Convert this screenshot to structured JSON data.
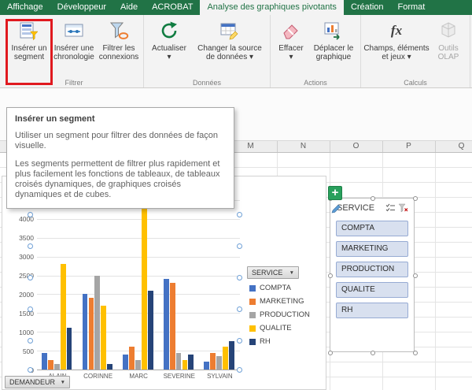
{
  "tab_bar": {
    "tabs": [
      {
        "label": "Affichage",
        "active": false
      },
      {
        "label": "Développeur",
        "active": false
      },
      {
        "label": "Aide",
        "active": false
      },
      {
        "label": "ACROBAT",
        "active": false
      },
      {
        "label": "Analyse des graphiques pivotants",
        "active": true
      },
      {
        "label": "Création",
        "active": false
      },
      {
        "label": "Format",
        "active": false
      }
    ]
  },
  "ribbon": {
    "groups": [
      {
        "label": "Filtrer",
        "buttons": [
          {
            "name": "insert-slicer",
            "line1": "Insérer un",
            "line2": "segment",
            "icon": "slicer-icon",
            "has_caret": false,
            "disabled": false
          },
          {
            "name": "insert-timeline",
            "line1": "Insérer une",
            "line2": "chronologie",
            "icon": "timeline-icon",
            "has_caret": false,
            "disabled": false
          },
          {
            "name": "filter-connections",
            "line1": "Filtrer les",
            "line2": "connexions",
            "icon": "filter-connections-icon",
            "has_caret": false,
            "disabled": false
          }
        ]
      },
      {
        "label": "Données",
        "buttons": [
          {
            "name": "refresh",
            "line1": "Actualiser",
            "line2": "",
            "icon": "refresh-icon",
            "has_caret": true,
            "disabled": false
          },
          {
            "name": "change-data-source",
            "line1": "Changer la source",
            "line2": "de données",
            "icon": "change-source-icon",
            "has_caret": true,
            "disabled": false
          }
        ]
      },
      {
        "label": "Actions",
        "buttons": [
          {
            "name": "clear",
            "line1": "Effacer",
            "line2": "",
            "icon": "clear-icon",
            "has_caret": true,
            "disabled": false
          },
          {
            "name": "move-chart",
            "line1": "Déplacer le",
            "line2": "graphique",
            "icon": "move-chart-icon",
            "has_caret": false,
            "disabled": false
          }
        ]
      },
      {
        "label": "Calculs",
        "buttons": [
          {
            "name": "fields-items-sets",
            "line1": "Champs, éléments",
            "line2": "et jeux",
            "icon": "fx-icon",
            "has_caret": true,
            "disabled": false
          },
          {
            "name": "olap-tools",
            "line1": "Outils",
            "line2": "OLAP",
            "icon": "olap-icon",
            "has_caret": false,
            "disabled": true
          }
        ]
      }
    ]
  },
  "tooltip": {
    "title": "Insérer un segment",
    "body1": "Utiliser un segment pour filtrer des données de façon visuelle.",
    "body2": "Les segments permettent de filtrer plus rapidement et plus facilement les fonctions de tableaux, de tableaux croisés dynamiques, de graphiques croisés dynamiques et de cubes."
  },
  "sheet": {
    "visible_columns": [
      "M",
      "N",
      "O",
      "P",
      "Q"
    ]
  },
  "chart_data": {
    "type": "bar",
    "title": "",
    "categories": [
      "ALAIN",
      "CORINNE",
      "MARC",
      "SEVERINE",
      "SYLVAIN"
    ],
    "series": [
      {
        "name": "COMPTA",
        "color": "#4472C4",
        "values": [
          450,
          2000,
          400,
          2400,
          200
        ]
      },
      {
        "name": "MARKETING",
        "color": "#ED7D31",
        "values": [
          250,
          1900,
          600,
          2300,
          450
        ]
      },
      {
        "name": "PRODUCTION",
        "color": "#A5A5A5",
        "values": [
          150,
          2500,
          250,
          450,
          350
        ]
      },
      {
        "name": "QUALITE",
        "color": "#FFC000",
        "values": [
          2800,
          1700,
          4500,
          250,
          600
        ]
      },
      {
        "name": "RH",
        "color": "#264478",
        "values": [
          1100,
          150,
          2100,
          400,
          750
        ]
      }
    ],
    "ylim": [
      0,
      4500
    ],
    "ytick_step": 500,
    "grid": true,
    "legend_title": "SERVICE",
    "legend_position": "right",
    "axis_field_button": "DEMANDEUR"
  },
  "slicer": {
    "title": "SERVICE",
    "items": [
      "COMPTA",
      "MARKETING",
      "PRODUCTION",
      "QUALITE",
      "RH"
    ]
  },
  "icons": {
    "caret_down": "▼",
    "plus": "+"
  },
  "colors": {
    "excel_green": "#217346",
    "annotation_red": "#E0191F"
  }
}
